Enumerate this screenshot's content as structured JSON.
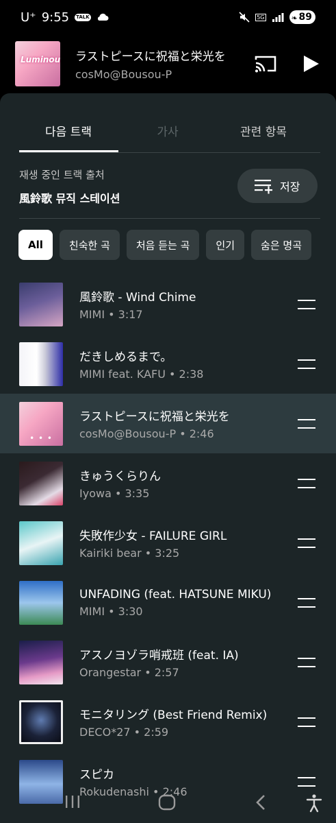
{
  "status_bar": {
    "carrier": "U⁺",
    "time": "9:55",
    "talk_badge": "TALK",
    "network": "5G",
    "battery": "89"
  },
  "now_playing": {
    "title": "ラストピースに祝福と栄光を",
    "artist": "cosMo@Bousou-P",
    "art_logo": "Luminous"
  },
  "tabs": [
    {
      "label": "다음 트랙"
    },
    {
      "label": "가사"
    },
    {
      "label": "관련 항목"
    }
  ],
  "queue_source": {
    "label": "재생 중인 트랙 출처",
    "name": "風鈴歌 뮤직 스테이션",
    "save_label": "저장"
  },
  "chips": [
    {
      "label": "All"
    },
    {
      "label": "친숙한 곡"
    },
    {
      "label": "처음 듣는 곡"
    },
    {
      "label": "인기"
    },
    {
      "label": "숨은 명곡"
    }
  ],
  "tracks": [
    {
      "title": "風鈴歌 - Wind Chime",
      "subtitle": "MIMI • 3:17"
    },
    {
      "title": "だきしめるまで。",
      "subtitle": "MIMI feat. KAFU • 2:38"
    },
    {
      "title": "ラストピースに祝福と栄光を",
      "subtitle": "cosMo@Bousou-P • 2:46"
    },
    {
      "title": "きゅうくらりん",
      "subtitle": "Iyowa • 3:35"
    },
    {
      "title": "失敗作少女 - FAILURE GIRL",
      "subtitle": "Kairiki bear • 3:25"
    },
    {
      "title": "UNFADING (feat. HATSUNE MIKU)",
      "subtitle": "MIMI • 3:30"
    },
    {
      "title": "アスノヨゾラ哨戒班 (feat. IA)",
      "subtitle": "Orangestar • 2:57"
    },
    {
      "title": "モニタリング (Best Friend Remix)",
      "subtitle": "DECO*27 • 2:59"
    },
    {
      "title": "スピカ",
      "subtitle": "Rokudenashi • 2:46"
    }
  ],
  "colors": {
    "panel_bg": "#1c2527",
    "current_row_bg": "#2d3b3f",
    "chip_bg": "#343d3f"
  }
}
